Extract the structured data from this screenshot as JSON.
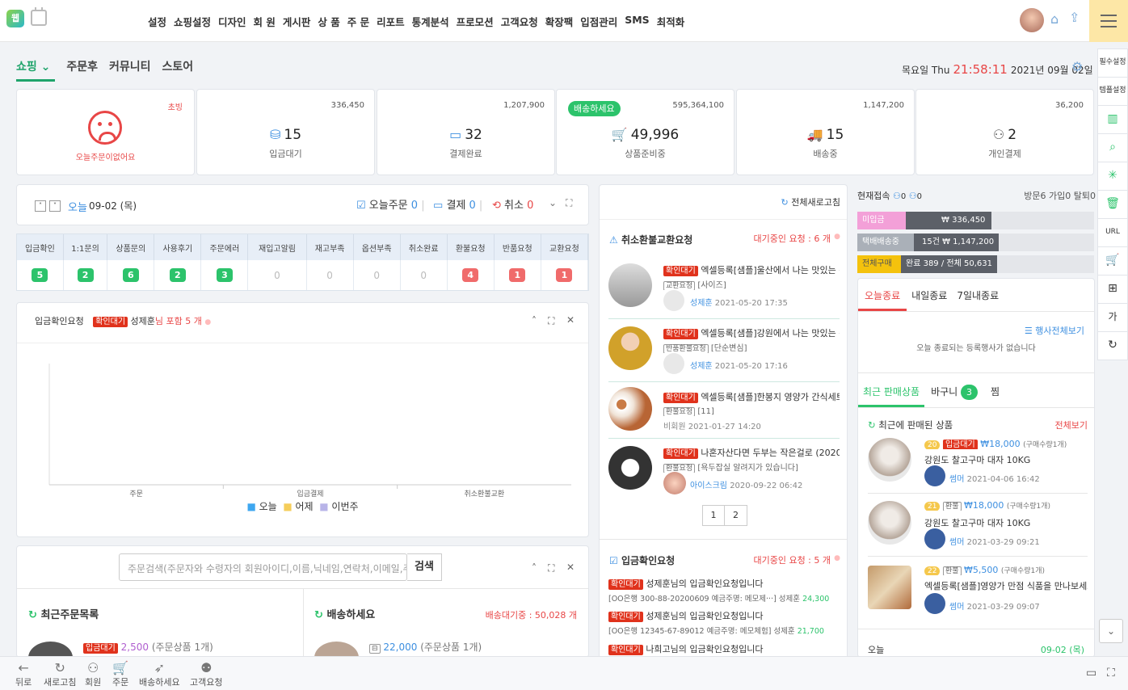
{
  "topnav": {
    "logo_text": "웹",
    "items": [
      "설정",
      "쇼핑설정",
      "디자인",
      "회 원",
      "게시판",
      "상 품",
      "주 문",
      "리포트",
      "통계분석",
      "프로모션",
      "고객요청",
      "확장팩",
      "입점관리",
      "SMS",
      "최적화"
    ]
  },
  "header": {
    "tabs": [
      "쇼핑",
      "주문후",
      "커뮤니티",
      "스토어"
    ],
    "day": "목요일 Thu",
    "time": "21:58:11",
    "date": "2021년 09월 02일"
  },
  "summary": {
    "empty_badge": "초빙",
    "empty_text": "오늘주문이없어요",
    "cards": [
      {
        "top": "336,450",
        "value": "15",
        "label": "입금대기",
        "icon": "database-icon"
      },
      {
        "top": "1,207,900",
        "value": "32",
        "label": "결제완료",
        "icon": "card-icon"
      },
      {
        "top": "595,364,100",
        "value": "49,996",
        "label": "상품준비중",
        "icon": "cart-icon",
        "badge": "배송하세요"
      },
      {
        "top": "1,147,200",
        "value": "15",
        "label": "배송중",
        "icon": "truck-icon"
      },
      {
        "top": "36,200",
        "value": "2",
        "label": "개인결제",
        "icon": "user-x-icon"
      }
    ]
  },
  "today": {
    "label": "오늘",
    "date": "09-02 (목)",
    "order_label": "오늘주문",
    "order_count": "0",
    "pay_label": "결제",
    "pay_count": "0",
    "cancel_label": "취소",
    "cancel_count": "0"
  },
  "status_table": {
    "headers": [
      "입금확인",
      "1:1문의",
      "상품문의",
      "사용후기",
      "주문에러",
      "재입고알림",
      "재고부족",
      "옵션부족",
      "취소완료",
      "환불요청",
      "반품요청",
      "교환요청"
    ],
    "values": [
      "5",
      "2",
      "6",
      "2",
      "3",
      "0",
      "0",
      "0",
      "0",
      "4",
      "1",
      "1"
    ]
  },
  "deposit_chart": {
    "title": "입금확인요청",
    "tag": "확인대기",
    "who": "성제훈",
    "suffix": "님 포함 5 개",
    "categories": [
      "주문",
      "입금결제",
      "취소환불교환"
    ],
    "legend": [
      "오늘",
      "어제",
      "이번주"
    ]
  },
  "chart_data": {
    "type": "bar",
    "categories": [
      "주문",
      "입금결제",
      "취소환불교환"
    ],
    "series": [
      {
        "name": "오늘",
        "values": [
          0,
          0,
          0
        ],
        "color": "#3ea7f0"
      },
      {
        "name": "어제",
        "values": [
          0,
          0,
          0
        ],
        "color": "#f5cd5a"
      },
      {
        "name": "이번주",
        "values": [
          0,
          0,
          0
        ],
        "color": "#b8b4e8"
      }
    ],
    "legend_position": "bottom"
  },
  "search": {
    "placeholder": "주문검색(주문자와 수령자의 회원아이디,이름,닉네임,연락처,이메일,주",
    "button": "검색"
  },
  "recent_orders": {
    "title": "최근주문목록",
    "tag": "입금대기",
    "price": "2,500",
    "qty": "(주문상품 1개)"
  },
  "ship_now": {
    "title": "배송하세요",
    "count_label": "배송대기중 : 50,028 개",
    "price": "22,000",
    "qty": "(주문상품 1개)"
  },
  "center": {
    "refresh": "전체새로고침",
    "cancel_title": "취소환불교환요청",
    "cancel_waiting": "대기중인 요청 : 6 개",
    "items": [
      {
        "tag": "확인대기",
        "title": "엑셀등록[샘플]울산에서 나는 맛있는 간식",
        "sub_tag": "교환요청",
        "sub": "[사이즈]",
        "user": "성제훈",
        "date": "2021-05-20 17:35"
      },
      {
        "tag": "확인대기",
        "title": "엑셀등록[샘플]강원에서 나는 맛있는 간식",
        "sub_tag": "반품환불요청",
        "sub": "[단순변심]",
        "user": "성제훈",
        "date": "2021-05-20 17:16"
      },
      {
        "tag": "확인대기",
        "title": "엑셀등록[샘플]한봉지 영양가 간식세트 (2",
        "sub_tag": "환불요청",
        "sub": "[11]",
        "user": "비회원",
        "date": "2021-01-27 14:20"
      },
      {
        "tag": "확인대기",
        "title": "나혼자산다면 두부는 작은걸로 (202009",
        "sub_tag": "환불요청",
        "sub": "[욕두잡실 알려지가 있습니다]",
        "user": "아이스크림",
        "date": "2020-09-22 06:42"
      }
    ],
    "pages": [
      "1",
      "2"
    ],
    "deposit_title": "입금확인요청",
    "deposit_waiting": "대기중인 요청 : 5 개",
    "deposits": [
      {
        "tag": "확인대기",
        "text": "성제훈님의 입금확인요청입니다",
        "detail": "[OO은행 300-88-20200609 예금주명: 메모제···] 성제훈",
        "amount": "24,300"
      },
      {
        "tag": "확인대기",
        "text": "성제훈님의 입금확인요청입니다",
        "detail": "[OO은행 12345-67-89012 예금주명: 메모체험] 성제훈",
        "amount": "21,700"
      },
      {
        "tag": "확인대기",
        "text": "나희고님의 입금확인요청입니다",
        "detail": "",
        "amount": ""
      }
    ]
  },
  "right": {
    "now_label": "현재접속",
    "now_a": "0",
    "now_b": "0",
    "visit_summary": "방문6 가입0 탈퇴0",
    "bars": [
      {
        "label": "미입금",
        "value": "₩ 336,450",
        "color": "#f3a0d8",
        "fill": 0.44
      },
      {
        "label": "택배배송중",
        "value": "15건 ₩ 1,147,200",
        "color": "#aab0b8",
        "fill": 0.24
      },
      {
        "label": "전체구매",
        "value": "완료 389 / 전체 50,631",
        "color": "#f4c20d",
        "fill": 0.18
      }
    ],
    "event_tabs": [
      "오늘종료",
      "내일종료",
      "7일내종료"
    ],
    "event_all": "행사전체보기",
    "event_empty": "오늘 종료되는 등록행사가 없습니다",
    "prod_tabs": [
      "최근 판매상품",
      "바구니",
      "찜"
    ],
    "cart_count": "3",
    "recent_title": "최근에 판매된 상품",
    "recent_all": "전체보기",
    "products": [
      {
        "num": "20",
        "tag": "입금대기",
        "price": "₩18,000",
        "qty": "(구매수량1개)",
        "name": "강원도 찰고구마 대자 10KG",
        "user": "썸머",
        "date": "2021-04-06 16:42"
      },
      {
        "num": "21",
        "tag": "환불",
        "price": "₩18,000",
        "qty": "(구매수량1개)",
        "name": "강원도 찰고구마 대자 10KG",
        "user": "썸머",
        "date": "2021-03-29 09:21"
      },
      {
        "num": "22",
        "tag": "환불",
        "price": "₩5,500",
        "qty": "(구매수량1개)",
        "name": "엑셀등록[샘플]영양가 만점 식품을 만나보세요",
        "user": "썸머",
        "date": "2021-03-29 09:07"
      }
    ],
    "today_label": "오늘",
    "today_date": "09-02 (목)"
  },
  "sidebar": [
    "필수설정",
    "템플설정",
    "chart-icon",
    "search-icon",
    "spinner-icon",
    "trash-icon",
    "URL",
    "cart-icon",
    "plus-box-icon",
    "가",
    "refresh-icon"
  ],
  "bottom": [
    "뒤로",
    "새로고침",
    "회원",
    "주문",
    "배송하세요",
    "고객요청"
  ]
}
